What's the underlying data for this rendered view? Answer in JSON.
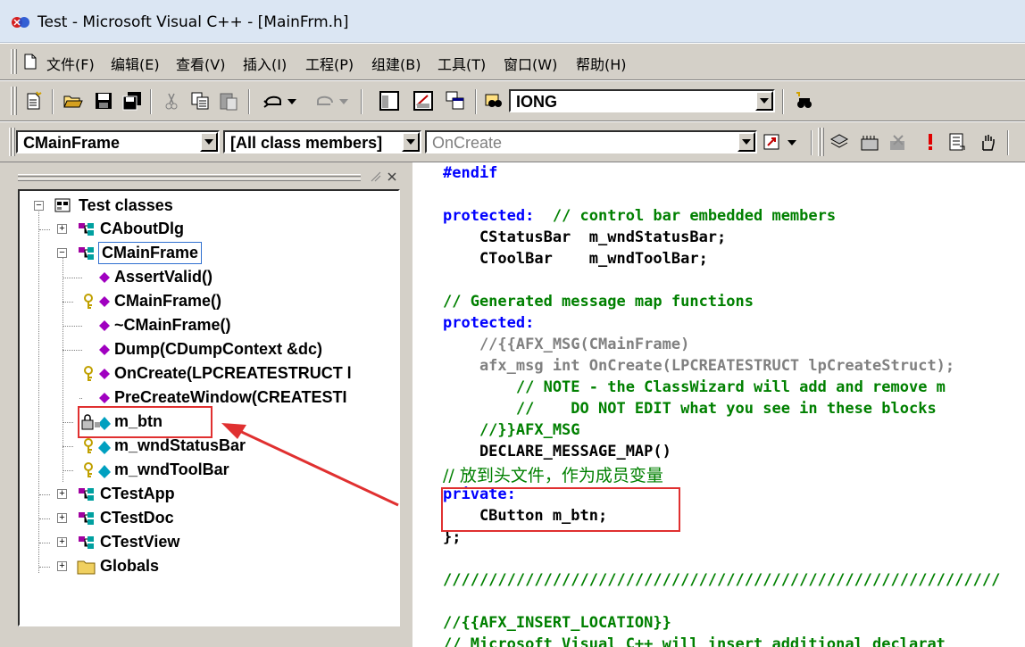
{
  "window": {
    "title": "Test - Microsoft Visual C++ - [MainFrm.h]"
  },
  "menu": {
    "items": [
      {
        "label": "文件(F)"
      },
      {
        "label": "编辑(E)"
      },
      {
        "label": "查看(V)"
      },
      {
        "label": "插入(I)"
      },
      {
        "label": "工程(P)"
      },
      {
        "label": "组建(B)"
      },
      {
        "label": "工具(T)"
      },
      {
        "label": "窗口(W)"
      },
      {
        "label": "帮助(H)"
      }
    ]
  },
  "toolbar1": {
    "find_combo_value": "IONG"
  },
  "toolbar2": {
    "class_combo_value": "CMainFrame",
    "filter_combo_value": "[All class members]",
    "member_combo_value": "OnCreate"
  },
  "tree": {
    "root": "Test classes",
    "nodes": [
      {
        "label": "CAboutDlg",
        "icon": "class-icon"
      },
      {
        "label": "CMainFrame",
        "icon": "class-icon",
        "selected": true
      },
      {
        "label": "AssertValid()",
        "icon": "method-icon"
      },
      {
        "label": "CMainFrame()",
        "icon": "key-method-icon"
      },
      {
        "label": "~CMainFrame()",
        "icon": "method-icon"
      },
      {
        "label": "Dump(CDumpContext &dc)",
        "icon": "method-icon"
      },
      {
        "label": "OnCreate(LPCREATESTRUCT l",
        "icon": "key-method-icon"
      },
      {
        "label": "PreCreateWindow(CREATESTI",
        "icon": "method-icon"
      },
      {
        "label": "m_btn",
        "icon": "private-member-icon"
      },
      {
        "label": "m_wndStatusBar",
        "icon": "key-member-icon"
      },
      {
        "label": "m_wndToolBar",
        "icon": "key-member-icon"
      },
      {
        "label": "CTestApp",
        "icon": "class-icon"
      },
      {
        "label": "CTestDoc",
        "icon": "class-icon"
      },
      {
        "label": "CTestView",
        "icon": "class-icon"
      },
      {
        "label": "Globals",
        "icon": "folder-icon"
      }
    ]
  },
  "code": {
    "lines": [
      "#endif",
      "",
      "protected:  // control bar embedded members",
      "    CStatusBar  m_wndStatusBar;",
      "    CToolBar    m_wndToolBar;",
      "",
      "// Generated message map functions",
      "protected:",
      "    //{{AFX_MSG(CMainFrame)",
      "    afx_msg int OnCreate(LPCREATESTRUCT lpCreateStruct);",
      "        // NOTE - the ClassWizard will add and remove m",
      "        //    DO NOT EDIT what you see in these blocks",
      "    //}}AFX_MSG",
      "    DECLARE_MESSAGE_MAP()",
      "// 放到头文件，作为成员变量",
      "private:",
      "    CButton m_btn;",
      "};",
      "",
      "/////////////////////////////////////////////////////////////",
      "",
      "//{{AFX_INSERT_LOCATION}}",
      "// Microsoft Visual C++ will insert additional declarat"
    ]
  },
  "colors": {
    "keyword": "#0000ff",
    "comment": "#008000",
    "inactive": "#808080",
    "annotation": "#e03030"
  }
}
